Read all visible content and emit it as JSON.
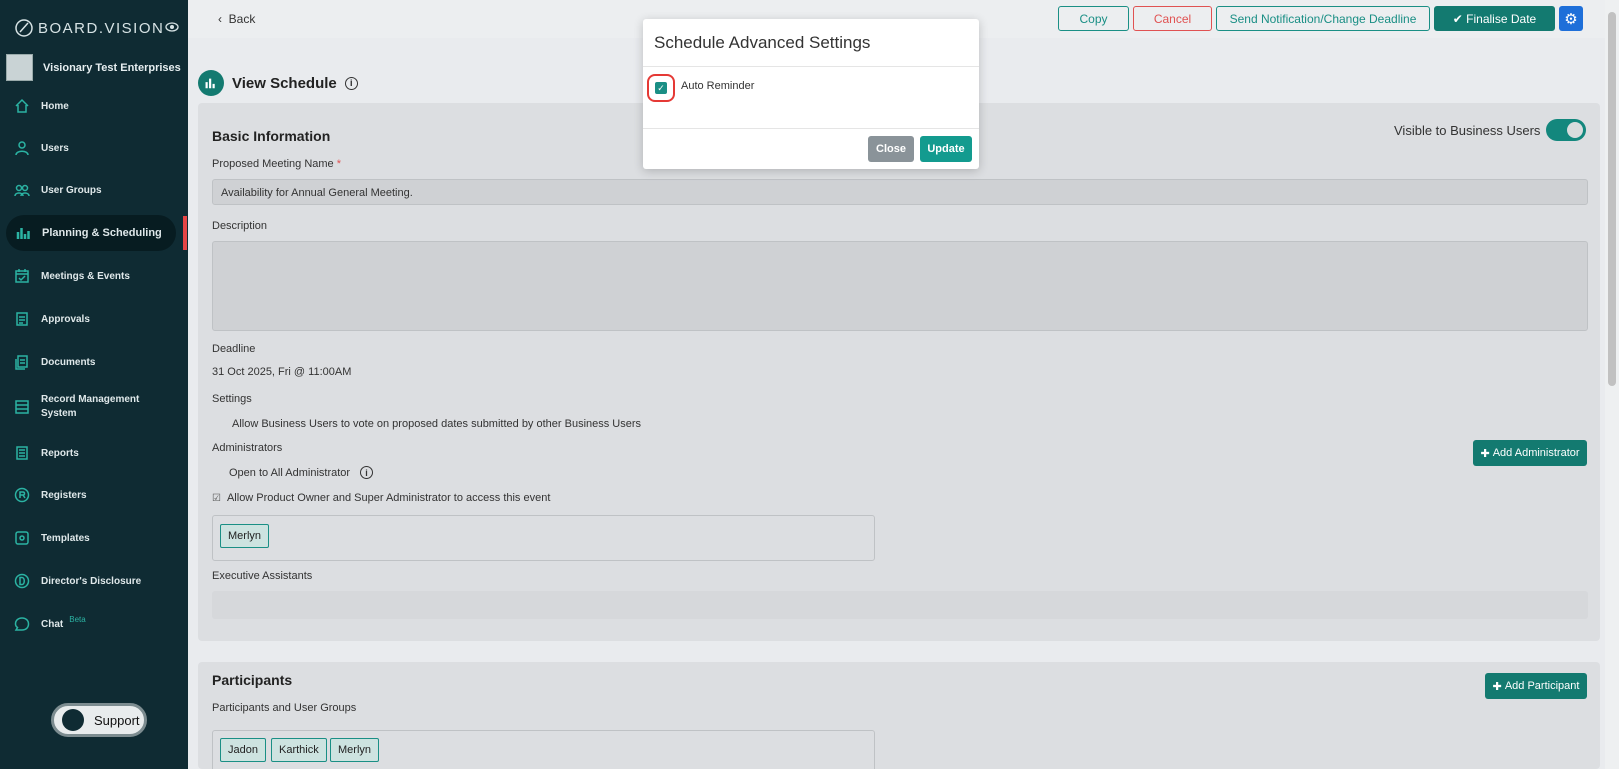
{
  "app": {
    "brand": "BOARD.VISION"
  },
  "sidebar": {
    "org_name": "Visionary Test Enterprises",
    "items": [
      {
        "label": "Home",
        "icon": "home-icon"
      },
      {
        "label": "Users",
        "icon": "user-icon"
      },
      {
        "label": "User Groups",
        "icon": "user-groups-icon"
      },
      {
        "label": "Planning & Scheduling",
        "icon": "bar-chart-icon"
      },
      {
        "label": "Meetings & Events",
        "icon": "calendar-icon"
      },
      {
        "label": "Approvals",
        "icon": "document-check-icon"
      },
      {
        "label": "Documents",
        "icon": "documents-icon"
      },
      {
        "label": "Record Management",
        "label2": "System",
        "icon": "records-icon"
      },
      {
        "label": "Reports",
        "icon": "report-icon"
      },
      {
        "label": "Registers",
        "icon": "registers-icon"
      },
      {
        "label": "Templates",
        "icon": "templates-icon"
      },
      {
        "label": "Director's Disclosure",
        "icon": "disclosure-icon"
      },
      {
        "label": "Chat",
        "badge": "Beta",
        "icon": "chat-icon"
      }
    ],
    "support_label": "Support"
  },
  "toolbar": {
    "back": "Back",
    "copy": "Copy",
    "cancel": "Cancel",
    "notify": "Send Notification/Change Deadline",
    "finalise": "Finalise Date",
    "settings_icon": "gear-icon"
  },
  "page": {
    "title": "View Schedule",
    "basic_info": "Basic Information",
    "visible_label": "Visible to Business Users",
    "visible_on": true,
    "meeting_name_label": "Proposed Meeting Name",
    "meeting_name_value": "Availability for Annual General Meeting.",
    "description_label": "Description",
    "description_value": "",
    "deadline_label": "Deadline",
    "deadline_value": "31 Oct 2025, Fri @ 11:00AM",
    "settings_label": "Settings",
    "settings_value": "Allow Business Users to vote on proposed dates submitted by other Business Users",
    "admins_label": "Administrators",
    "add_admin": "Add Administrator",
    "open_admin": "Open to All Administrator",
    "allow_owner": "Allow Product Owner and Super Administrator to access this event",
    "admins": [
      "Merlyn"
    ],
    "exec_label": "Executive Assistants",
    "participants_h": "Participants",
    "participants_label": "Participants and User Groups",
    "add_participant": "Add Participant",
    "participants": [
      "Jadon",
      "Karthick",
      "Merlyn"
    ]
  },
  "modal": {
    "title": "Schedule Advanced Settings",
    "auto_reminder_label": "Auto Reminder",
    "auto_reminder_checked": true,
    "close": "Close",
    "update": "Update"
  }
}
